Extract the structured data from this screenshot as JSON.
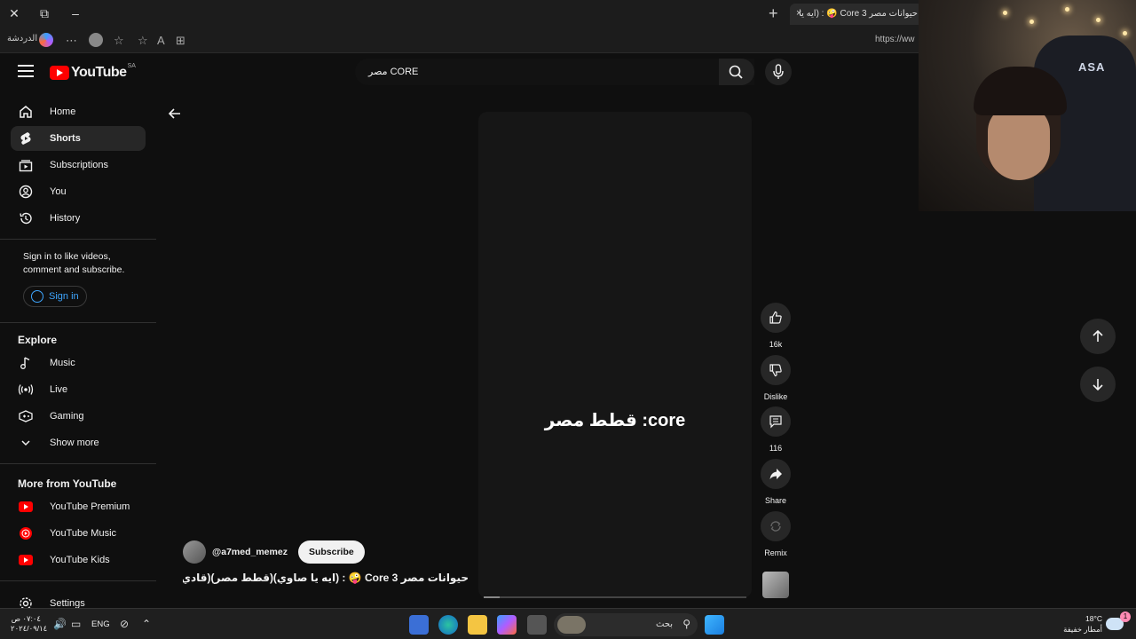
{
  "browser": {
    "tab_title": "حيوانات مصر Core 3 🤪 : (ايه يا",
    "url": "https://ww",
    "chat_label": "الدردشة",
    "new_tab": "+",
    "close": "×"
  },
  "youtube": {
    "logo_text": "YouTube",
    "country": "SA",
    "search_value": "مصر CORE",
    "sidebar": {
      "main": [
        {
          "label": "Home",
          "icon": "home-icon"
        },
        {
          "label": "Shorts",
          "icon": "shorts-icon",
          "active": true
        },
        {
          "label": "Subscriptions",
          "icon": "subscriptions-icon"
        },
        {
          "label": "You",
          "icon": "you-icon"
        },
        {
          "label": "History",
          "icon": "history-icon"
        }
      ],
      "signin_prompt": "Sign in to like videos, comment and subscribe.",
      "signin_button": "Sign in",
      "explore_title": "Explore",
      "explore": [
        {
          "label": "Music",
          "icon": "music-icon"
        },
        {
          "label": "Live",
          "icon": "live-icon"
        },
        {
          "label": "Gaming",
          "icon": "gaming-icon"
        },
        {
          "label": "Show more",
          "icon": "chevron-down-icon"
        }
      ],
      "more_title": "More from YouTube",
      "more": [
        {
          "label": "YouTube Premium",
          "icon": "youtube-premium-icon"
        },
        {
          "label": "YouTube Music",
          "icon": "youtube-music-icon"
        },
        {
          "label": "YouTube Kids",
          "icon": "youtube-kids-icon"
        }
      ],
      "settings": "Settings"
    },
    "short": {
      "overlay_text": "قطط مصر :core",
      "channel": "@a7med_memez",
      "subscribe": "Subscribe",
      "title": "حيوانات مصر Core 3 🤪 : (ايه يا صاوي)(قطط مصر)(قادي ...",
      "likes": "16k",
      "dislike": "Dislike",
      "comments": "116",
      "share": "Share",
      "remix": "Remix",
      "progress": 0.06
    }
  },
  "webcam": {
    "brand": "ASA"
  },
  "taskbar": {
    "time": "٠٧:٠٤ ص",
    "date": "٢٠٢٤/٠٩/١٤",
    "lang": "ENG",
    "search": "بحث",
    "temp": "18°C",
    "weather": "أمطار خفيفة",
    "badge": "1"
  }
}
